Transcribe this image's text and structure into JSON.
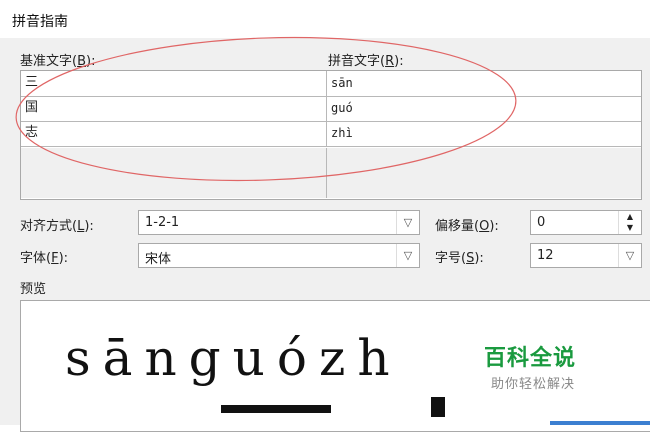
{
  "window": {
    "title": "拼音指南"
  },
  "labels": {
    "base_text": "基准文字(",
    "base_key": "B",
    "base_tail": "):",
    "pinyin_text": "拼音文字(",
    "pinyin_key": "R",
    "pinyin_tail": "):"
  },
  "rows": [
    {
      "base": "三",
      "pinyin": "sān"
    },
    {
      "base": "国",
      "pinyin": "guó"
    },
    {
      "base": "志",
      "pinyin": "zhì"
    },
    {
      "base": "",
      "pinyin": ""
    },
    {
      "base": "",
      "pinyin": ""
    }
  ],
  "alignment": {
    "label": "对齐方式(",
    "key": "L",
    "tail": "):",
    "value": "1-2-1"
  },
  "offset": {
    "label": "偏移量(",
    "key": "O",
    "tail": "):",
    "value": "0"
  },
  "font": {
    "label": "字体(",
    "key": "F",
    "tail": "):",
    "value": "宋体"
  },
  "size": {
    "label": "字号(",
    "key": "S",
    "tail": "):",
    "value": "12"
  },
  "preview": {
    "label": "预览",
    "text": "sānguózh"
  },
  "watermark": {
    "main": "百科全说",
    "sub": "助你轻松解决"
  },
  "colors": {
    "annotation_ellipse": "#e06666",
    "watermark": "#1a9a3f",
    "accent": "#3c7fd1"
  }
}
